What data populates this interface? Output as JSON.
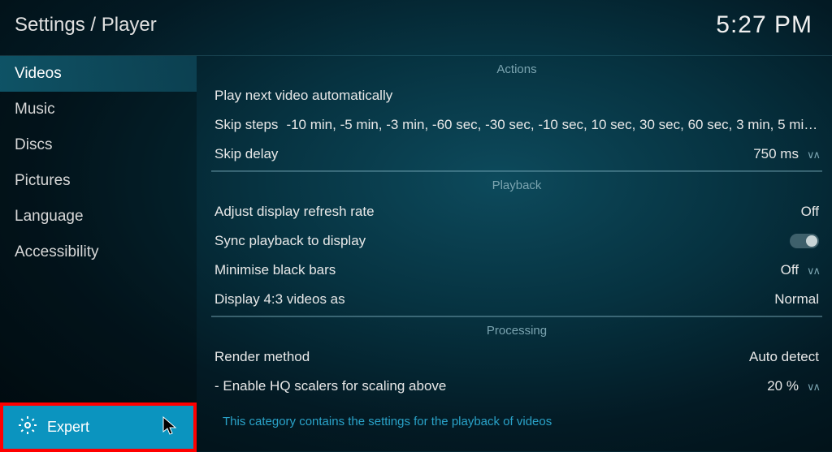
{
  "header": {
    "breadcrumb": "Settings / Player",
    "clock": "5:27 PM"
  },
  "sidebar": {
    "items": [
      {
        "label": "Videos",
        "active": true
      },
      {
        "label": "Music"
      },
      {
        "label": "Discs"
      },
      {
        "label": "Pictures"
      },
      {
        "label": "Language"
      },
      {
        "label": "Accessibility"
      }
    ],
    "level_label": "Expert"
  },
  "sections": {
    "actions": {
      "title": "Actions",
      "play_next_label": "Play next video automatically",
      "skip_steps_label": "Skip steps",
      "skip_steps_value": "-10 min, -5 min, -3 min, -60 sec, -30 sec, -10 sec, 10 sec, 30 sec, 60 sec, 3 min, 5 min,...",
      "skip_delay_label": "Skip delay",
      "skip_delay_value": "750 ms"
    },
    "playback": {
      "title": "Playback",
      "refresh_label": "Adjust display refresh rate",
      "refresh_value": "Off",
      "sync_label": "Sync playback to display",
      "black_bars_label": "Minimise black bars",
      "black_bars_value": "Off",
      "aspect_label": "Display 4:3 videos as",
      "aspect_value": "Normal"
    },
    "processing": {
      "title": "Processing",
      "render_label": "Render method",
      "render_value": "Auto detect",
      "hq_label": "- Enable HQ scalers for scaling above",
      "hq_value": "20 %"
    }
  },
  "footer": {
    "help": "This category contains the settings for the playback of videos"
  }
}
